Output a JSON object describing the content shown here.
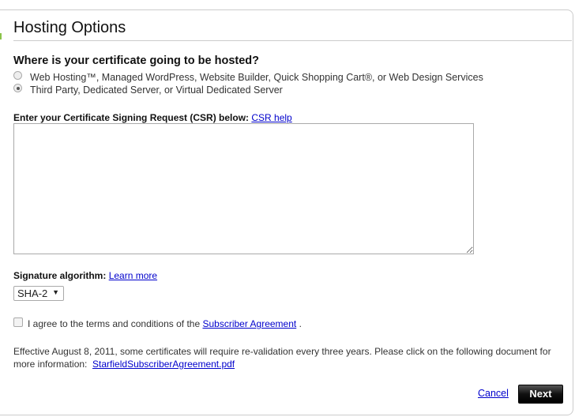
{
  "title": "Hosting Options",
  "question": "Where is your certificate going to be hosted?",
  "options": [
    {
      "label": "Web Hosting™, Managed WordPress, Website Builder, Quick Shopping Cart®, or Web Design Services",
      "selected": false
    },
    {
      "label": "Third Party, Dedicated Server, or Virtual Dedicated Server",
      "selected": true
    }
  ],
  "csr": {
    "label": "Enter your Certificate Signing Request (CSR) below:",
    "help_link": "CSR help",
    "value": ""
  },
  "signature": {
    "label": "Signature algorithm:",
    "learn_more": "Learn more",
    "selected": "SHA-2"
  },
  "agree": {
    "checked": false,
    "text_before": "I agree to the terms and conditions of the",
    "link": "Subscriber Agreement",
    "text_after": "."
  },
  "effective": {
    "text": "Effective August 8, 2011, some certificates will require re-validation every three years. Please click on the following document for more information:",
    "link": "StarfieldSubscriberAgreement.pdf"
  },
  "actions": {
    "cancel": "Cancel",
    "next": "Next"
  }
}
